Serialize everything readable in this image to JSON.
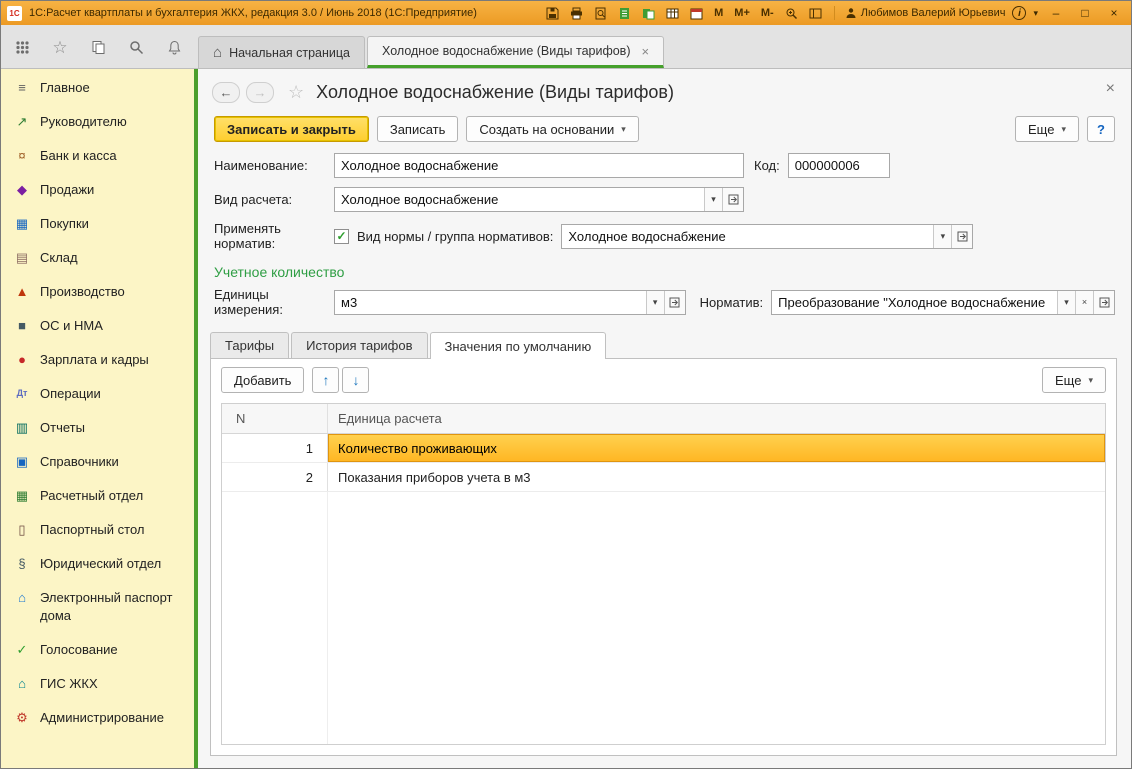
{
  "colors": {
    "titlebar_orange": "#f0a232",
    "sidebar_yellow": "#fcf5c6",
    "accent_green": "#4c9e2c",
    "selection_orange": "#ffc13b",
    "save_button_yellow": "#ffd93b",
    "section_header_green": "#2f9e44"
  },
  "icons": {
    "dropdown": "▾",
    "back": "←",
    "forward": "→",
    "star": "☆",
    "home": "⌂",
    "close": "×",
    "check": "✓",
    "up": "↑",
    "down": "↓",
    "minimize": "–",
    "maximize": "□",
    "info": "i",
    "caret": "▾"
  },
  "titlebar": {
    "logo": "1С",
    "title": "1С:Расчет квартплаты и бухгалтерия ЖКХ, редакция 3.0 / Июнь 2018 (1С:Предприятие)",
    "mem": [
      "M",
      "M+",
      "M-"
    ],
    "user": "Любимов Валерий Юрьевич"
  },
  "tabbar": {
    "home_tab": "Начальная страница",
    "active_tab": "Холодное водоснабжение (Виды тарифов)"
  },
  "sidebar": {
    "items": [
      {
        "label": "Главное",
        "glyph": "≡"
      },
      {
        "label": "Руководителю",
        "glyph": "↗"
      },
      {
        "label": "Банк и касса",
        "glyph": "¤"
      },
      {
        "label": "Продажи",
        "glyph": "◆"
      },
      {
        "label": "Покупки",
        "glyph": "▦"
      },
      {
        "label": "Склад",
        "glyph": "▤"
      },
      {
        "label": "Производство",
        "glyph": "▲"
      },
      {
        "label": "ОС и НМА",
        "glyph": "■"
      },
      {
        "label": "Зарплата и кадры",
        "glyph": "●"
      },
      {
        "label": "Операции",
        "glyph": "Дт"
      },
      {
        "label": "Отчеты",
        "glyph": "▥"
      },
      {
        "label": "Справочники",
        "glyph": "▣"
      },
      {
        "label": "Расчетный отдел",
        "glyph": "▦"
      },
      {
        "label": "Паспортный стол",
        "glyph": "▯"
      },
      {
        "label": "Юридический отдел",
        "glyph": "§"
      },
      {
        "label": "Электронный паспорт дома",
        "glyph": "⌂"
      },
      {
        "label": "Голосование",
        "glyph": "✓"
      },
      {
        "label": "ГИС ЖКХ",
        "glyph": "⌂"
      },
      {
        "label": "Администрирование",
        "glyph": "⚙"
      }
    ]
  },
  "form": {
    "title": "Холодное водоснабжение (Виды тарифов)",
    "buttons": {
      "save_close": "Записать и закрыть",
      "save": "Записать",
      "create_based": "Создать на основании",
      "more": "Еще",
      "help": "?"
    },
    "fields": {
      "name_label": "Наименование:",
      "name_value": "Холодное водоснабжение",
      "code_label": "Код:",
      "code_value": "000000006",
      "calc_type_label": "Вид расчета:",
      "calc_type_value": "Холодное водоснабжение",
      "apply_norm_label": "Применять норматив:",
      "norm_group_label": "Вид нормы / группа нормативов:",
      "norm_group_value": "Холодное водоснабжение",
      "section_header": "Учетное количество",
      "units_label": "Единицы измерения:",
      "units_value": "м3",
      "normative_label": "Норматив:",
      "normative_value": "Преобразование \"Холодное водоснабжение"
    },
    "tabs": [
      "Тарифы",
      "История тарифов",
      "Значения по умолчанию"
    ],
    "active_tab": "Значения по умолчанию",
    "toolbar": {
      "add": "Добавить",
      "more": "Еще"
    },
    "table": {
      "columns": [
        "N",
        "Единица расчета"
      ],
      "rows": [
        {
          "n": "1",
          "value": "Количество проживающих",
          "selected": true
        },
        {
          "n": "2",
          "value": "Показания приборов учета в м3",
          "selected": false
        }
      ]
    }
  }
}
